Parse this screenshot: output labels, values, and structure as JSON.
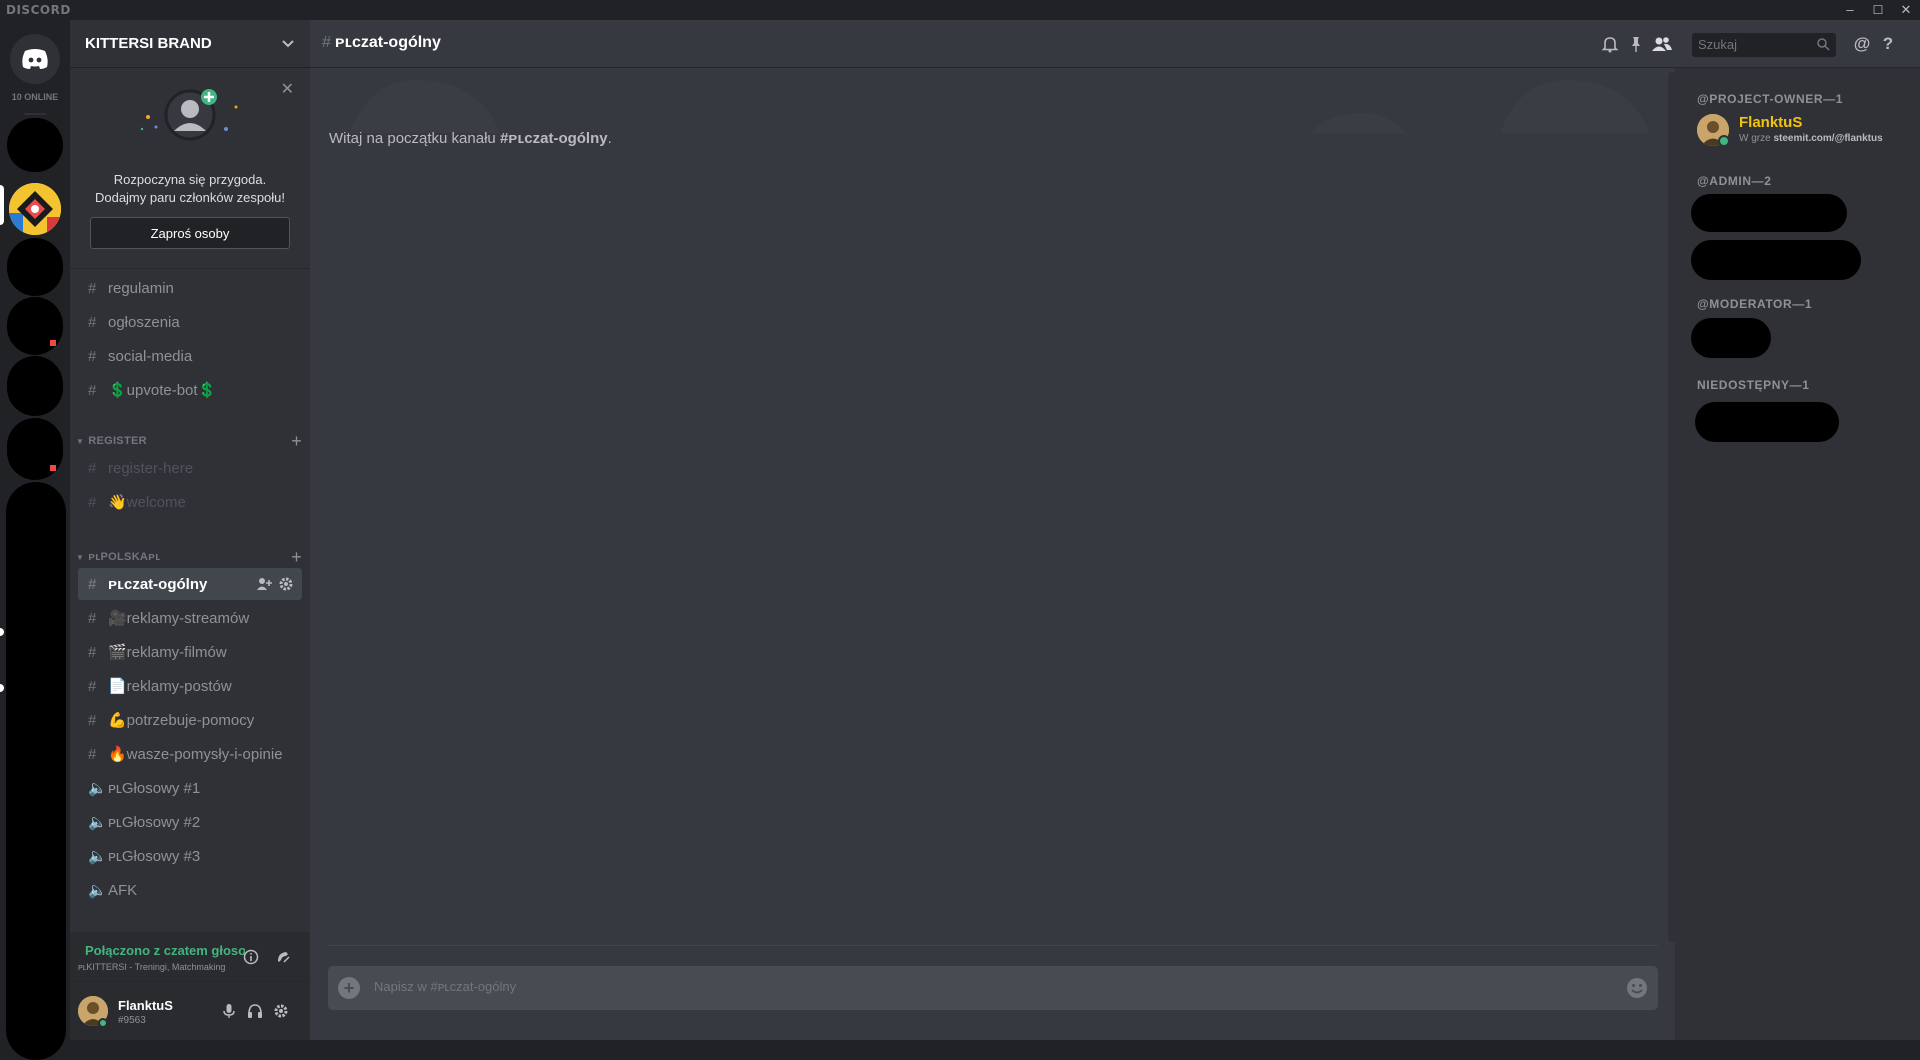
{
  "titlebar": {
    "brand": "DISCORD",
    "min": "–",
    "max": "☐",
    "close": "✕"
  },
  "rail": {
    "online": "10 ONLINE"
  },
  "guild": {
    "name": "KITTERSI BRAND"
  },
  "invite": {
    "line1": "Rozpoczyna się przygoda.",
    "line2": "Dodajmy paru członków zespołu!",
    "button": "Zaproś osoby"
  },
  "channels": {
    "top": [
      "regulamin",
      "ogłoszenia",
      "social-media",
      "💲upvote-bot💲"
    ],
    "register_cat": "REGISTER",
    "register": [
      "register-here",
      "👋welcome"
    ],
    "polska_cat": "ᴘʟPOLSKAᴘʟ",
    "polska": [
      "ᴘʟczat-ogólny",
      "🎥reklamy-streamów",
      "🎬reklamy-filmów",
      "📄reklamy-postów",
      "💪potrzebuje-pomocy",
      "🔥wasze-pomysły-i-opinie",
      "ᴘʟGłosowy #1",
      "ᴘʟGłosowy #2",
      "ᴘʟGłosowy #3",
      "AFK"
    ]
  },
  "voice": {
    "status": "Połączono z czatem głosowym",
    "sub": "ᴘʟKITTERSI - Treningi, Matchmaking"
  },
  "user": {
    "name": "FlanktuS",
    "tag": "#9563"
  },
  "chat": {
    "channel": "ᴘʟczat-ogólny",
    "welcome_pre": "Witaj na początku kanału ",
    "welcome_channel": "#ᴘʟczat-ogólny",
    "welcome_post": ".",
    "search_placeholder": "Szukaj",
    "composer_placeholder": "Napisz w #ᴘʟczat-ogólny"
  },
  "members": {
    "roles": [
      {
        "label": "@PROJECT-OWNER—1"
      },
      {
        "label": "@ADMIN—2"
      },
      {
        "label": "@MODERATOR—1"
      },
      {
        "label": "NIEDOSTĘPNY—1"
      }
    ],
    "owner": {
      "name": "FlanktuS",
      "game_prefix": "W grze ",
      "game": "steemit.com/@flanktus"
    }
  },
  "colors": {
    "accent": "#7289da",
    "online": "#43b581",
    "owner_role": "#f1c40f",
    "bg_main": "#36393f",
    "bg_side": "#2f3136",
    "bg_rail": "#202225"
  }
}
